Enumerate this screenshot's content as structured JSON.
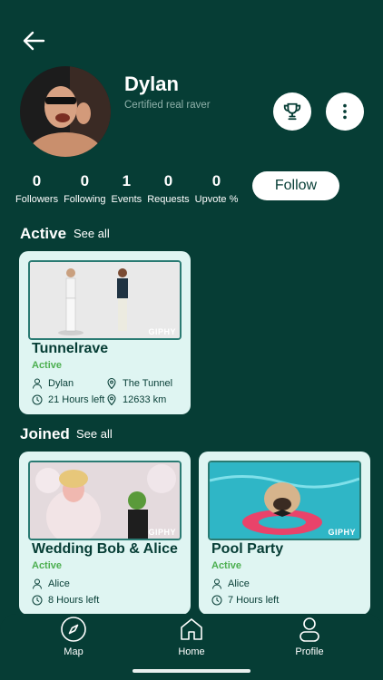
{
  "profile": {
    "name": "Dylan",
    "subtitle": "Certified real raver"
  },
  "stats": [
    {
      "value": "0",
      "label": "Followers"
    },
    {
      "value": "0",
      "label": "Following"
    },
    {
      "value": "1",
      "label": "Events"
    },
    {
      "value": "0",
      "label": "Requests"
    },
    {
      "value": "0",
      "label": "Upvote %"
    }
  ],
  "follow_label": "Follow",
  "active": {
    "title": "Active",
    "see_all": "See all",
    "events": [
      {
        "title": "Tunnelrave",
        "status": "Active",
        "host": "Dylan",
        "location": "The Tunnel",
        "time_left": "21 Hours left",
        "distance": "12633 km",
        "badge": "GIPHY"
      }
    ]
  },
  "joined": {
    "title": "Joined",
    "see_all": "See all",
    "events": [
      {
        "title": "Wedding Bob & Alice",
        "status": "Active",
        "host": "Alice",
        "time_left": "8 Hours left",
        "badge": "GIPHY"
      },
      {
        "title": "Pool Party",
        "status": "Active",
        "host": "Alice",
        "time_left": "7 Hours left",
        "badge": "GIPHY"
      }
    ]
  },
  "nav": [
    {
      "label": "Map",
      "icon": "compass-icon"
    },
    {
      "label": "Home",
      "icon": "home-icon"
    },
    {
      "label": "Profile",
      "icon": "profile-icon"
    }
  ],
  "colors": {
    "background": "#063d35",
    "card": "#dff5f2",
    "active_status": "#4caf50"
  }
}
